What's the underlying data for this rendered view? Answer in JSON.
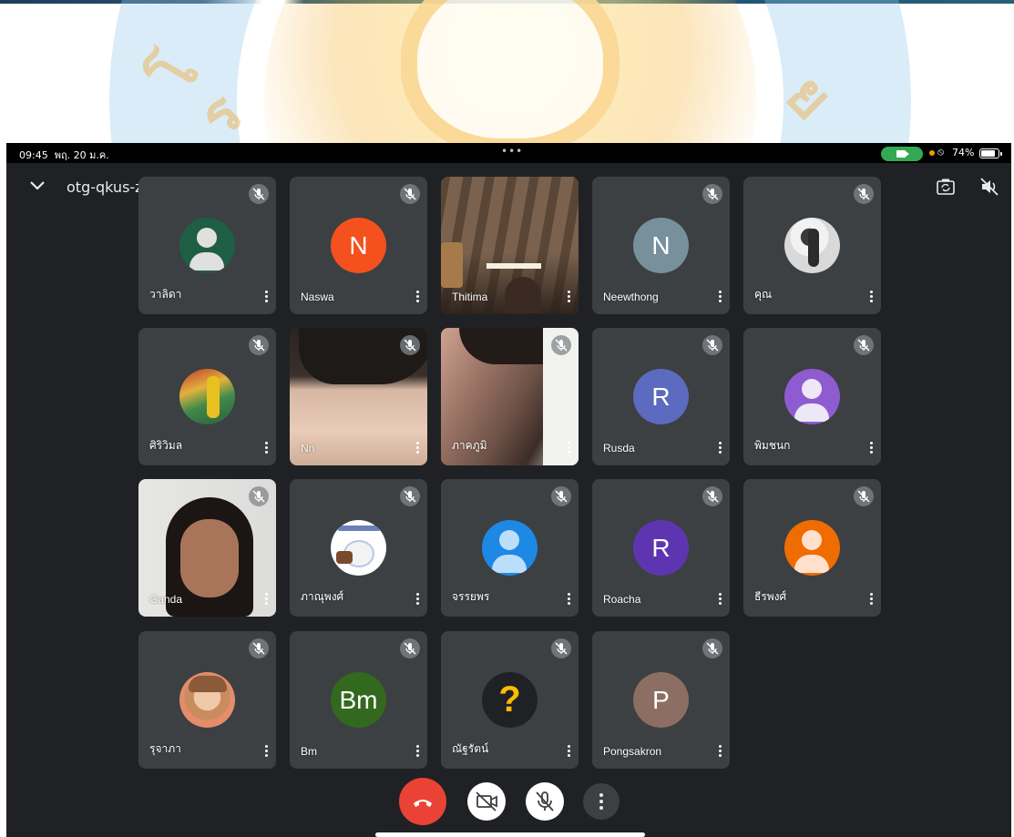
{
  "status_bar": {
    "time": "09:45",
    "date": "พฤ. 20 ม.ค.",
    "dots": "•••",
    "battery": "74%",
    "lock_glyph": "⦸"
  },
  "header": {
    "meeting_code": "otg-qkus-zvi",
    "arrow_glyph": "▸",
    "back_icon": "chevron-down-icon",
    "switch_camera_icon": "camera-switch-icon",
    "speaker_icon": "volume-off-icon"
  },
  "participants": [
    {
      "name": "วาลิดา",
      "avatar_type": "person-icon",
      "avatar_bg": "#1e5e45",
      "muted": true
    },
    {
      "name": "Naswa",
      "avatar_type": "initial",
      "initial": "N",
      "avatar_bg": "#f4511e",
      "muted": true
    },
    {
      "name": "Thitima",
      "avatar_type": "video",
      "muted": false
    },
    {
      "name": "Neewthong",
      "avatar_type": "initial",
      "initial": "N",
      "avatar_bg": "#78909c",
      "muted": true
    },
    {
      "name": "คุณ",
      "avatar_type": "photo",
      "muted": true
    },
    {
      "name": "ศิริวิมล",
      "avatar_type": "photo",
      "muted": true
    },
    {
      "name": "Nn",
      "avatar_type": "video",
      "muted": true
    },
    {
      "name": "ภาคภูมิ",
      "avatar_type": "video",
      "muted": true
    },
    {
      "name": "Rusda",
      "avatar_type": "initial",
      "initial": "R",
      "avatar_bg": "#5c6bc0",
      "muted": true
    },
    {
      "name": "พิมชนก",
      "avatar_type": "person-icon",
      "avatar_bg": "#8e5bd1",
      "muted": true
    },
    {
      "name": "Ganda",
      "avatar_type": "video",
      "muted": true
    },
    {
      "name": "ภาณุพงศ์",
      "avatar_type": "photo",
      "muted": true
    },
    {
      "name": "จรรยพร",
      "avatar_type": "person-icon",
      "avatar_bg": "#1e88e5",
      "muted": true
    },
    {
      "name": "Roacha",
      "avatar_type": "initial",
      "initial": "R",
      "avatar_bg": "#5e35b1",
      "muted": true
    },
    {
      "name": "ธีรพงศ์",
      "avatar_type": "person-icon",
      "avatar_bg": "#ef6c00",
      "muted": true
    },
    {
      "name": "รุจาภา",
      "avatar_type": "photo",
      "muted": true
    },
    {
      "name": "Bm",
      "avatar_type": "initial",
      "initial": "Bm",
      "avatar_bg": "#33691e",
      "muted": true
    },
    {
      "name": "ณัฐรัตน์",
      "avatar_type": "question",
      "initial": "?",
      "avatar_bg": "#202124",
      "muted": true
    },
    {
      "name": "Pongsakron",
      "avatar_type": "initial",
      "initial": "P",
      "avatar_bg": "#8d6e63",
      "muted": true
    }
  ],
  "controls": {
    "end_call_icon": "phone-hangup-icon",
    "camera_icon": "video-off-icon",
    "mic_icon": "mic-off-icon",
    "more_icon": "more-vertical-icon"
  },
  "colors": {
    "meet_bg": "#202124",
    "tile_bg": "#3c4043",
    "end_call": "#ea4335",
    "status_green": "#34a853"
  }
}
